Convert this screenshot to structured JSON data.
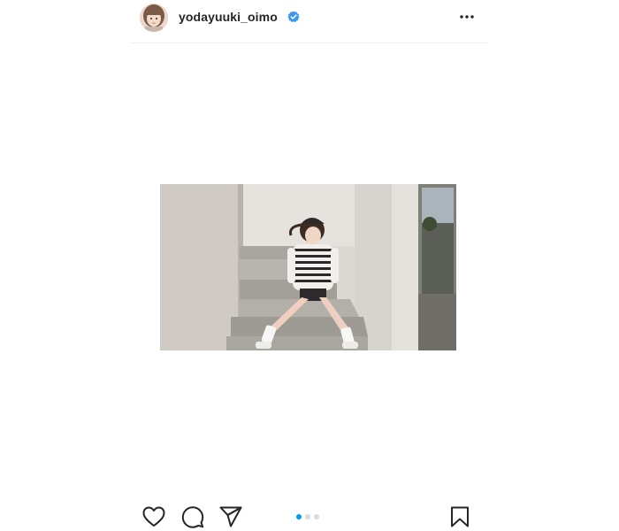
{
  "post": {
    "header": {
      "username": "yodayuuki_oimo",
      "avatar_icon": "profile-photo",
      "verified_icon": "verified-badge-icon",
      "more_icon": "more-horizontal-icon"
    },
    "media": {
      "image_icon": "photo-woman-sitting-on-stairs"
    },
    "actions": {
      "like_icon": "heart-icon",
      "comment_icon": "comment-icon",
      "share_icon": "send-icon",
      "save_icon": "bookmark-icon"
    },
    "carousel": {
      "total": 3,
      "active_index": 0
    }
  },
  "colors": {
    "accent": "#0095f6",
    "text": "#262626",
    "divider": "#efefef",
    "inactive_dot": "#dbdbdb"
  }
}
